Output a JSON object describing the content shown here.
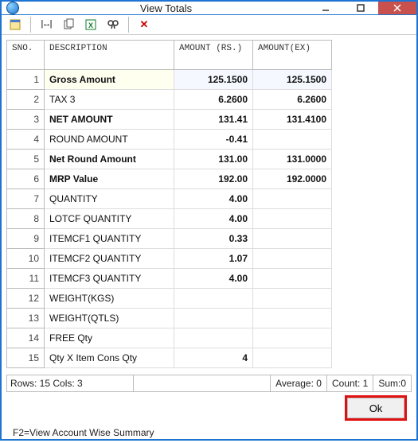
{
  "window": {
    "title": "View Totals"
  },
  "toolbar": {
    "icons": [
      "form-icon",
      "width-icon",
      "copy-icon",
      "excel-icon",
      "find-icon",
      "delete-icon"
    ]
  },
  "columns": {
    "sno": "SNO.",
    "desc": "DESCRIPTION",
    "amt": "AMOUNT (RS.)",
    "amtex": "AMOUNT(EX)"
  },
  "rows": [
    {
      "sno": "1",
      "desc": "Gross Amount",
      "amt": "125.1500",
      "amtex": "125.1500",
      "style": "bold-blue",
      "highlight": true
    },
    {
      "sno": "2",
      "desc": "TAX 3",
      "amt": "6.2600",
      "amtex": "6.2600",
      "style": "plain"
    },
    {
      "sno": "3",
      "desc": "NET AMOUNT",
      "amt": "131.41",
      "amtex": "131.4100",
      "style": "bold-blue"
    },
    {
      "sno": "4",
      "desc": "ROUND AMOUNT",
      "amt": "-0.41",
      "amtex": "",
      "style": "plain"
    },
    {
      "sno": "5",
      "desc": "Net Round Amount",
      "amt": "131.00",
      "amtex": "131.0000",
      "style": "bold-red"
    },
    {
      "sno": "6",
      "desc": "MRP Value",
      "amt": "192.00",
      "amtex": "192.0000",
      "style": "bold"
    },
    {
      "sno": "7",
      "desc": "QUANTITY",
      "amt": "4.00",
      "amtex": "",
      "style": "olive"
    },
    {
      "sno": "8",
      "desc": "LOTCF    QUANTITY",
      "amt": "4.00",
      "amtex": "",
      "style": "olive"
    },
    {
      "sno": "9",
      "desc": "ITEMCF1   QUANTITY",
      "amt": "0.33",
      "amtex": "",
      "style": "blue"
    },
    {
      "sno": "10",
      "desc": "ITEMCF2   QUANTITY",
      "amt": "1.07",
      "amtex": "",
      "style": "green"
    },
    {
      "sno": "11",
      "desc": "ITEMCF3    QUANTITY",
      "amt": "4.00",
      "amtex": "",
      "style": "purple"
    },
    {
      "sno": "12",
      "desc": "WEIGHT(KGS)",
      "amt": "",
      "amtex": "",
      "style": "plain"
    },
    {
      "sno": "13",
      "desc": "WEIGHT(QTLS)",
      "amt": "",
      "amtex": "",
      "style": "plain"
    },
    {
      "sno": "14",
      "desc": "FREE Qty",
      "amt": "",
      "amtex": "",
      "style": "plain"
    },
    {
      "sno": "15",
      "desc": "Qty X Item Cons Qty",
      "amt": "4",
      "amtex": "",
      "style": "plain"
    }
  ],
  "status": {
    "rows_cols": "Rows: 15  Cols: 3",
    "average": "Average: 0",
    "count": "Count: 1",
    "sum": "Sum:0"
  },
  "buttons": {
    "ok": "Ok"
  },
  "hint": "F2=View Account Wise Summary"
}
